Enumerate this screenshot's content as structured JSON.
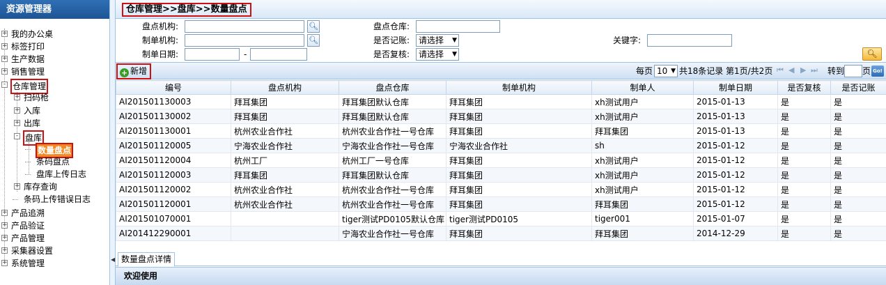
{
  "sidebar": {
    "title": "资源管理器",
    "items": [
      {
        "label": "我的办公桌",
        "level": 0,
        "expander": "+"
      },
      {
        "label": "标签打印",
        "level": 0,
        "expander": "+"
      },
      {
        "label": "生产数据",
        "level": 0,
        "expander": "+"
      },
      {
        "label": "销售管理",
        "level": 0,
        "expander": "+"
      },
      {
        "label": "仓库管理",
        "level": 0,
        "expander": "-"
      },
      {
        "label": "扫码枪",
        "level": 1,
        "expander": "+"
      },
      {
        "label": "入库",
        "level": 1,
        "expander": "+"
      },
      {
        "label": "出库",
        "level": 1,
        "expander": "+"
      },
      {
        "label": "盘库",
        "level": 1,
        "expander": "-"
      },
      {
        "label": "数量盘点",
        "level": 2,
        "expander": ""
      },
      {
        "label": "条码盘点",
        "level": 2,
        "expander": ""
      },
      {
        "label": "盘库上传日志",
        "level": 2,
        "expander": ""
      },
      {
        "label": "库存查询",
        "level": 1,
        "expander": "+"
      },
      {
        "label": "条码上传错误日志",
        "level": 1,
        "expander": ""
      },
      {
        "label": "产品追溯",
        "level": 0,
        "expander": "+"
      },
      {
        "label": "产品验证",
        "level": 0,
        "expander": "+"
      },
      {
        "label": "产品管理",
        "level": 0,
        "expander": "+"
      },
      {
        "label": "采集器设置",
        "level": 0,
        "expander": "+"
      },
      {
        "label": "系统管理",
        "level": 0,
        "expander": "+"
      }
    ]
  },
  "breadcrumb": "仓库管理>>盘库>>数量盘点",
  "query": {
    "org_label": "盘点机构:",
    "org_value": "",
    "maker_org_label": "制单机构:",
    "maker_org_value": "",
    "date_label": "制单日期:",
    "date_from": "",
    "date_sep": "-",
    "date_to": "",
    "warehouse_label": "盘点仓库:",
    "warehouse_value": "",
    "booked_label": "是否记账:",
    "booked_value": "请选择",
    "reviewed_label": "是否复核:",
    "reviewed_value": "请选择",
    "keyword_label": "关键字:",
    "keyword_value": ""
  },
  "toolbar": {
    "add_label": "新增",
    "per_page_label": "每页",
    "per_page_value": "10",
    "total_text": "共18条记录",
    "page_text": "第1页/共2页",
    "goto_label": "转到",
    "page_unit": "页",
    "go_label": "Go!"
  },
  "table": {
    "columns": [
      "编号",
      "盘点机构",
      "盘点仓库",
      "制单机构",
      "制单人",
      "制单日期",
      "是否复核",
      "是否记账"
    ],
    "rows": [
      [
        "AI201501130003",
        "拜耳集团",
        "拜耳集团默认仓库",
        "拜耳集团",
        "xh测试用户",
        "2015-01-13",
        "是",
        "是"
      ],
      [
        "AI201501130002",
        "拜耳集团",
        "拜耳集团默认仓库",
        "拜耳集团",
        "xh测试用户",
        "2015-01-13",
        "是",
        "是"
      ],
      [
        "AI201501130001",
        "杭州农业合作社",
        "杭州农业合作社一号仓库",
        "拜耳集团",
        "拜耳集团",
        "2015-01-13",
        "是",
        "是"
      ],
      [
        "AI201501120005",
        "宁海农业合作社",
        "宁海农业合作社一号仓库",
        "宁海农业合作社",
        "sh",
        "2015-01-12",
        "是",
        "是"
      ],
      [
        "AI201501120004",
        "杭州工厂",
        "杭州工厂一号仓库",
        "拜耳集团",
        "xh测试用户",
        "2015-01-12",
        "是",
        "是"
      ],
      [
        "AI201501120003",
        "拜耳集团",
        "拜耳集团默认仓库",
        "拜耳集团",
        "xh测试用户",
        "2015-01-12",
        "是",
        "是"
      ],
      [
        "AI201501120002",
        "杭州农业合作社",
        "杭州农业合作社一号仓库",
        "拜耳集团",
        "xh测试用户",
        "2015-01-12",
        "是",
        "是"
      ],
      [
        "AI201501120001",
        "杭州农业合作社",
        "杭州农业合作社一号仓库",
        "拜耳集团",
        "拜耳集团",
        "2015-01-12",
        "是",
        "是"
      ],
      [
        "AI201501070001",
        "",
        "tiger测试PD0105默认仓库",
        "tiger测试PD0105",
        "tiger001",
        "2015-01-07",
        "是",
        "是"
      ],
      [
        "AI201412290001",
        "",
        "宁海农业合作社一号仓库",
        "拜耳集团",
        "拜耳集团",
        "2014-12-29",
        "是",
        "是"
      ]
    ]
  },
  "detail_tab": "数量盘点详情",
  "welcome": "欢迎使用",
  "colors": {
    "accent": "#1d5595",
    "highlight": "#d01010",
    "active_leaf": "#f08a24"
  },
  "icons": {
    "search": "magnifier-icon",
    "add": "plus-icon",
    "query": "search-icon"
  }
}
